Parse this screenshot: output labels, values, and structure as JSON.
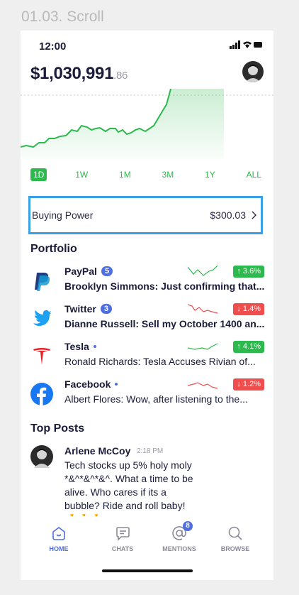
{
  "frame_title": "01.03. Scroll",
  "status": {
    "time": "12:00"
  },
  "balance": {
    "main": "$1,030,991",
    "cents": ".86"
  },
  "ranges": [
    "1D",
    "1W",
    "1M",
    "3M",
    "1Y",
    "ALL"
  ],
  "buying_power": {
    "label": "Buying Power",
    "value": "$300.03"
  },
  "portfolio": {
    "title": "Portfolio",
    "items": [
      {
        "name": "PayPal",
        "badge": "5",
        "message": "Brooklyn Simmons: Just confirming that...",
        "change": "↑ 3.6%",
        "direction": "up"
      },
      {
        "name": "Twitter",
        "badge": "3",
        "message": "Dianne Russell: Sell my October 1400 an...",
        "change": "↓ 1.4%",
        "direction": "down"
      },
      {
        "name": "Tesla",
        "badge": "",
        "message": "Ronald Richards: Tesla Accuses Rivian of...",
        "change": "↑ 4.1%",
        "direction": "up"
      },
      {
        "name": "Facebook",
        "badge": "",
        "message": "Albert Flores: Wow, after listening to the...",
        "change": "↓ 1.2%",
        "direction": "down"
      }
    ]
  },
  "top_posts": {
    "title": "Top Posts",
    "post": {
      "author": "Arlene McCoy",
      "time": "2:18 PM",
      "text": "Tech stocks up 5% holy moly *&^*&^*&^. What a time to be alive. Who cares if its a bubble? Ride and roll baby! 🤞🤞🤞"
    }
  },
  "tabs": {
    "home": "HOME",
    "chats": "CHATS",
    "mentions": "MENTIONS",
    "mentions_badge": "8",
    "browse": "BROWSE"
  },
  "colors": {
    "accent": "#4f6ee0",
    "up": "#2db94d",
    "down": "#f04e4e",
    "highlight": "#3aa0e6"
  }
}
